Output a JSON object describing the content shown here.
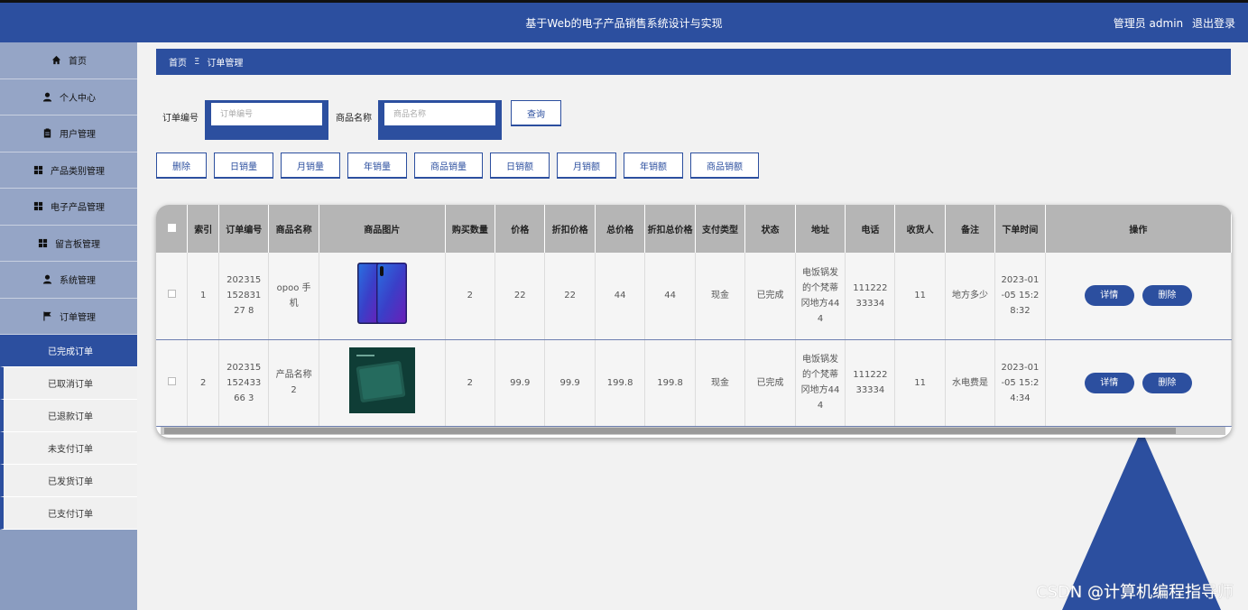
{
  "header": {
    "title": "基于Web的电子产品销售系统设计与实现",
    "user": "管理员 admin",
    "logout": "退出登录"
  },
  "sidebar": {
    "items": [
      {
        "label": "首页",
        "icon": "home-icon"
      },
      {
        "label": "个人中心",
        "icon": "user-icon"
      },
      {
        "label": "用户管理",
        "icon": "clipboard-icon"
      },
      {
        "label": "产品类别管理",
        "icon": "grid-icon"
      },
      {
        "label": "电子产品管理",
        "icon": "grid-icon"
      },
      {
        "label": "留言板管理",
        "icon": "grid-icon"
      },
      {
        "label": "系统管理",
        "icon": "user-icon"
      },
      {
        "label": "订单管理",
        "icon": "flag-icon"
      }
    ],
    "subitems": [
      "已完成订单",
      "已取消订单",
      "已退款订单",
      "未支付订单",
      "已发货订单",
      "已支付订单"
    ]
  },
  "breadcrumb": {
    "home": "首页",
    "sep": "Ξ",
    "current": "订单管理"
  },
  "search": {
    "order_label": "订单编号",
    "order_placeholder": "订单编号",
    "product_label": "商品名称",
    "product_placeholder": "商品名称",
    "query": "查询"
  },
  "toolbar": [
    "删除",
    "日销量",
    "月销量",
    "年销量",
    "商品销量",
    "日销额",
    "月销额",
    "年销额",
    "商品销额"
  ],
  "table": {
    "headers": [
      "索引",
      "订单编号",
      "商品名称",
      "商品图片",
      "购买数量",
      "价格",
      "折扣价格",
      "总价格",
      "折扣总价格",
      "支付类型",
      "状态",
      "地址",
      "电话",
      "收货人",
      "备注",
      "下单时间",
      "操作"
    ],
    "rows": [
      {
        "index": "1",
        "order_no": "20231515283127 8",
        "name": "opoo 手机",
        "qty": "2",
        "price": "22",
        "discount": "22",
        "total": "44",
        "discount_total": "44",
        "pay": "现金",
        "status": "已完成",
        "address": "电饭锅发的个梵蒂冈地方444",
        "phone": "11122233334",
        "receiver": "11",
        "note": "地方多少",
        "time": "2023-01-05 15:28:32",
        "image": "phone"
      },
      {
        "index": "2",
        "order_no": "20231515243366 3",
        "name": "产品名称2",
        "qty": "2",
        "price": "99.9",
        "discount": "99.9",
        "total": "199.8",
        "discount_total": "199.8",
        "pay": "现金",
        "status": "已完成",
        "address": "电饭锅发的个梵蒂冈地方444",
        "phone": "11122233334",
        "receiver": "11",
        "note": "水电费是",
        "time": "2023-01-05 15:24:34",
        "image": "powerbank"
      }
    ],
    "detail_btn": "详情",
    "delete_btn": "删除"
  },
  "watermark": "CSDN @计算机编程指导师",
  "colors": {
    "primary": "#2c4f9f",
    "sidebar": "#95a5c6"
  }
}
